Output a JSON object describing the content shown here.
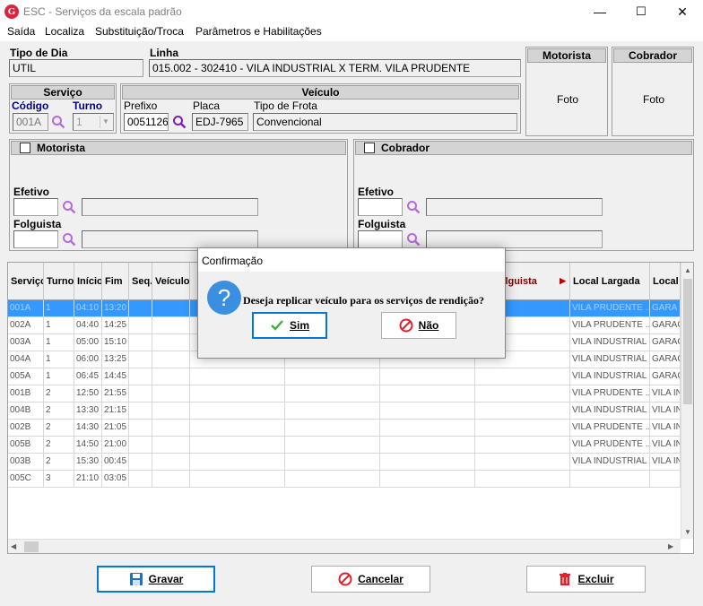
{
  "window": {
    "title": "ESC - Serviços da escala padrão",
    "minimize": "—",
    "maximize": "☐",
    "close": "✕"
  },
  "menu": [
    "Saída",
    "Localiza",
    "Substituição/Troca",
    "Parâmetros e Habilitações"
  ],
  "tipo_dia": {
    "label": "Tipo de Dia",
    "value": "UTIL"
  },
  "linha": {
    "label": "Linha",
    "value": "015.002 - 302410 - VILA INDUSTRIAL X TERM. VILA PRUDENTE"
  },
  "motorista_foto": {
    "title": "Motorista",
    "foto": "Foto"
  },
  "cobrador_foto": {
    "title": "Cobrador",
    "foto": "Foto"
  },
  "servico": {
    "title": "Serviço",
    "codigo_label": "Código",
    "codigo": "001A",
    "turno_label": "Turno",
    "turno": "1"
  },
  "veiculo": {
    "title": "Veículo",
    "prefixo_label": "Prefixo",
    "prefixo": "0051126",
    "placa_label": "Placa",
    "placa": "EDJ-7965",
    "frota_label": "Tipo de Frota",
    "frota": "Convencional"
  },
  "motorista_group": {
    "title": "Motorista",
    "efetivo_label": "Efetivo",
    "folguista_label": "Folguista"
  },
  "cobrador_group": {
    "title": "Cobrador",
    "efetivo_label": "Efetivo",
    "folguista_label": "Folguista"
  },
  "grid": {
    "headers": [
      "Serviço",
      "Turno",
      "Início",
      "Fim",
      "Seq.",
      "Veículo",
      "",
      "",
      "",
      "Folguista",
      "Local Largada",
      "Local"
    ],
    "rows": [
      [
        "001A",
        "1",
        "04:10",
        "13:20",
        "VILA PRUDENTE ...",
        "GARA"
      ],
      [
        "002A",
        "1",
        "04:40",
        "14:25",
        "VILA PRUDENTE ...",
        "GARAG"
      ],
      [
        "003A",
        "1",
        "05:00",
        "15:10",
        "VILA INDUSTRIAL",
        "GARAG"
      ],
      [
        "004A",
        "1",
        "06:00",
        "13:25",
        "VILA INDUSTRIAL",
        "GARAG"
      ],
      [
        "005A",
        "1",
        "06:45",
        "14:45",
        "VILA INDUSTRIAL",
        "GARAG"
      ],
      [
        "001B",
        "2",
        "12:50",
        "21:55",
        "VILA PRUDENTE ...",
        "VILA IN"
      ],
      [
        "004B",
        "2",
        "13:30",
        "21:15",
        "VILA INDUSTRIAL",
        "VILA IN"
      ],
      [
        "002B",
        "2",
        "14:30",
        "21:05",
        "VILA PRUDENTE ...",
        "VILA IN"
      ],
      [
        "005B",
        "2",
        "14:50",
        "21:00",
        "VILA PRUDENTE ...",
        "VILA IN"
      ],
      [
        "003B",
        "2",
        "15:30",
        "00:45",
        "VILA INDUSTRIAL",
        "VILA IN"
      ],
      [
        "005C",
        "3",
        "21:10",
        "03:05",
        "",
        ""
      ]
    ]
  },
  "buttons": {
    "gravar": "Gravar",
    "cancelar": "Cancelar",
    "excluir": "Excluir"
  },
  "dialog": {
    "title": "Confirmação",
    "message": "Deseja replicar veículo para os serviços de rendição?",
    "sim": "Sim",
    "nao": "Não"
  },
  "colors": {
    "selection": "#3399ff",
    "accent_blue": "#000080",
    "icon_purple": "#8a2be2"
  }
}
